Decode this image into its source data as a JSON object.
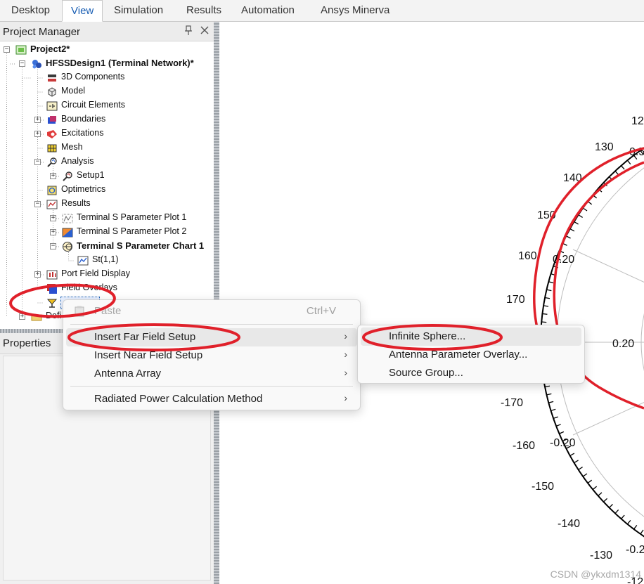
{
  "ribbon": {
    "tabs": [
      {
        "label": "Desktop"
      },
      {
        "label": "View"
      },
      {
        "label": "Simulation"
      },
      {
        "label": "Results"
      },
      {
        "label": "Automation"
      },
      {
        "label": "Ansys Minerva"
      }
    ],
    "active_tab": "View"
  },
  "project_manager": {
    "title": "Project Manager",
    "tree": [
      {
        "label": "Project2*",
        "bold": true,
        "icon": "project-icon"
      },
      {
        "label": "HFSSDesign1 (Terminal Network)*",
        "bold": true,
        "icon": "hfss-design-icon"
      },
      {
        "label": "3D Components",
        "icon": "3d-components-icon"
      },
      {
        "label": "Model",
        "icon": "model-icon"
      },
      {
        "label": "Circuit Elements",
        "icon": "circuit-elements-icon"
      },
      {
        "label": "Boundaries",
        "icon": "boundaries-icon"
      },
      {
        "label": "Excitations",
        "icon": "excitations-icon"
      },
      {
        "label": "Mesh",
        "icon": "mesh-icon"
      },
      {
        "label": "Analysis",
        "icon": "analysis-icon"
      },
      {
        "label": "Setup1",
        "icon": "setup-icon"
      },
      {
        "label": "Optimetrics",
        "icon": "optimetrics-icon"
      },
      {
        "label": "Results",
        "icon": "results-icon"
      },
      {
        "label": "Terminal S Parameter Plot 1",
        "icon": "rect-plot-icon"
      },
      {
        "label": "Terminal S Parameter Plot 2",
        "icon": "color-plot-icon"
      },
      {
        "label": "Terminal S Parameter Chart 1",
        "bold": true,
        "icon": "smith-chart-icon"
      },
      {
        "label": "St(1,1)",
        "icon": "trace-icon"
      },
      {
        "label": "Port Field Display",
        "icon": "port-field-icon"
      },
      {
        "label": "Field Overlays",
        "icon": "field-overlays-icon"
      },
      {
        "label": "",
        "icon": "radiation-icon"
      },
      {
        "label": "Defi",
        "icon": "folder-icon"
      }
    ]
  },
  "properties": {
    "title": "Properties"
  },
  "context_menu": {
    "items": [
      {
        "label": "Paste",
        "shortcut": "Ctrl+V",
        "disabled": true
      },
      {
        "label": "Insert Far Field Setup",
        "submenu": true,
        "hover": true
      },
      {
        "label": "Insert Near Field Setup",
        "submenu": true
      },
      {
        "label": "Antenna Array",
        "submenu": true
      },
      {
        "label": "Radiated Power Calculation Method",
        "submenu": true
      }
    ]
  },
  "submenu": {
    "items": [
      {
        "label": "Infinite Sphere...",
        "hover": true
      },
      {
        "label": "Antenna Parameter Overlay..."
      },
      {
        "label": "Source Group..."
      }
    ]
  },
  "polar_chart": {
    "angle_labels": [
      "12",
      "130",
      "140",
      "150",
      "160",
      "170",
      "-170",
      "-160",
      "-150",
      "-140",
      "-130",
      "-12"
    ],
    "radius_labels": [
      "0.50",
      "0.20",
      "0.20",
      "0.20",
      "-0.20",
      "-0.2"
    ]
  },
  "annotations": {
    "color": "#e0202a"
  },
  "watermark": "CSDN @ykxdm1314"
}
